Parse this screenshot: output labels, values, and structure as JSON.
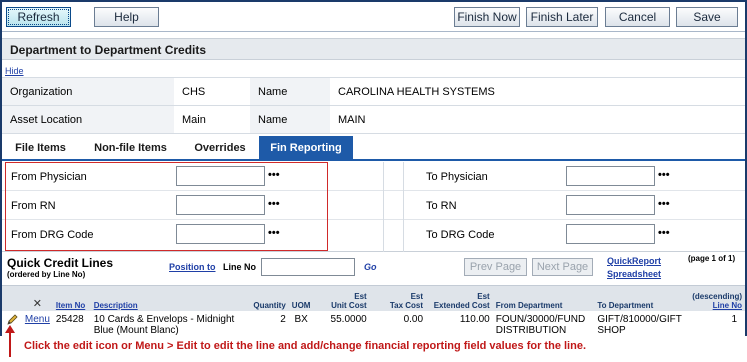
{
  "toolbar": {
    "refresh": "Refresh",
    "help": "Help",
    "finish_now": "Finish Now",
    "finish_later": "Finish Later",
    "cancel": "Cancel",
    "save": "Save"
  },
  "page_title": "Department to Department Credits",
  "hide_link": "Hide",
  "header": {
    "org_label": "Organization",
    "org_value": "CHS",
    "org_name_label": "Name",
    "org_name_value": "CAROLINA HEALTH SYSTEMS",
    "loc_label": "Asset Location",
    "loc_value": "Main",
    "loc_name_label": "Name",
    "loc_name_value": "MAIN"
  },
  "tabs": [
    "File Items",
    "Non-file Items",
    "Overrides",
    "Fin Reporting"
  ],
  "active_tab": "Fin Reporting",
  "fields": {
    "from_physician": "From Physician",
    "from_rn": "From RN",
    "from_drg": "From DRG Code",
    "to_physician": "To Physician",
    "to_rn": "To RN",
    "to_drg": "To DRG Code",
    "lookup": "•••"
  },
  "quick_lines": {
    "title": "Quick Credit Lines",
    "subtitle": "(ordered by Line No)",
    "position_to": "Position to",
    "line_no_label": "Line No",
    "go": "Go",
    "prev_page": "Prev Page",
    "next_page": "Next Page",
    "quick_report": "QuickReport",
    "spreadsheet": "Spreadsheet",
    "page_of": "(page 1 of 1)"
  },
  "grid": {
    "headers": {
      "delete": "✕",
      "item_no": "Item No",
      "description": "Description",
      "quantity": "Quantity",
      "uom": "UOM",
      "est_unit_1": "Est",
      "est_unit_2": "Unit Cost",
      "est_tax_1": "Est",
      "est_tax_2": "Tax Cost",
      "est_ext_1": "Est",
      "est_ext_2": "Extended Cost",
      "from_dept": "From Department",
      "to_dept": "To Department",
      "line_no_1": "(descending)",
      "line_no_2": "Line No"
    },
    "row": {
      "menu": "Menu",
      "item_no": "25428",
      "description": "10 Cards & Envelops - Midnight Blue (Mount Blanc)",
      "quantity": "2",
      "uom": "BX",
      "unit_cost": "55.0000",
      "tax_cost": "0.00",
      "extended_cost": "110.00",
      "from_department": "FOUN/30000/FUND DISTRIBUTION",
      "to_department": "GIFT/810000/GIFT SHOP",
      "line_no": "1"
    }
  },
  "footnote": "Click the edit icon or Menu > Edit to edit the line and add/change financial reporting field values for the line.",
  "colors": {
    "accent": "#1e5aa8",
    "annotation_red": "#c01818",
    "link": "#1f3fa6"
  }
}
